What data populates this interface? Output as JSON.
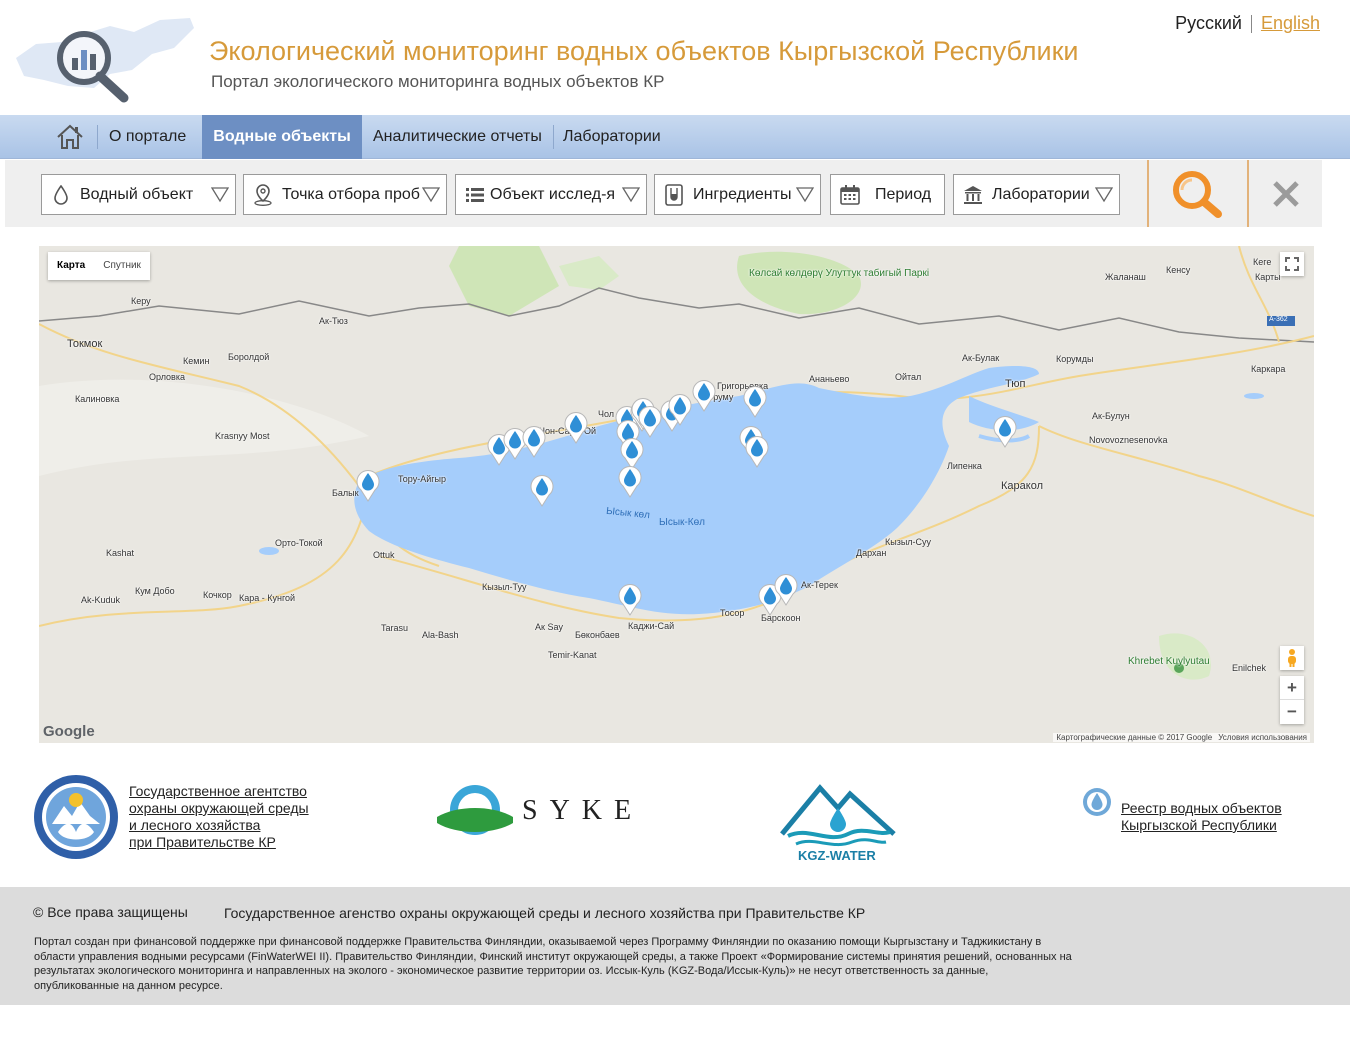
{
  "header": {
    "title": "Экологический мониторинг водных объектов Кыргызской Республики",
    "subtitle": "Портал экологического мониторинга водных объектов КР",
    "lang_ru": "Русский",
    "lang_en": "English"
  },
  "nav": {
    "items": [
      {
        "label": "О портале"
      },
      {
        "label": "Водные объекты",
        "active": true
      },
      {
        "label": "Аналитические отчеты"
      },
      {
        "label": "Лаборатории"
      }
    ]
  },
  "filters": {
    "water_object": "Водный объект",
    "sampling_point": "Точка отбора проб",
    "research_object": "Объект исслед-я",
    "ingredients": "Ингредиенты",
    "period": "Период",
    "laboratories": "Лаборатории"
  },
  "map": {
    "type_map": "Карта",
    "type_satellite": "Спутник",
    "attribution": "Картографические данные © 2017 Google",
    "terms": "Условия использования",
    "google": "Google",
    "labels": {
      "kerу": "Керу",
      "ak_tyuz": "Ак-Тюз",
      "tokmok": "Токмок",
      "kemin": "Кемин",
      "borolday": "Боролдой",
      "orlovka": "Орловка",
      "kalinovka": "Калиновка",
      "krasny_most": "Krasnyy Most",
      "balykchy": "Балык",
      "toru_aygyr": "Тору-Айгыр",
      "chon_sary_oy": "Чон-Сары-Ой",
      "cholpon": "Чол",
      "koruma": "Коруму",
      "grigorevka": "Григорьевка",
      "ananevo": "Ананьево",
      "oytal": "Ойтал",
      "park": "Көлсай көлдөрү Улуттук табигый Паркі",
      "zhalanash": "Жаланаш",
      "kensu": "Кенсу",
      "kegen": "Кеге",
      "karty": "Карты",
      "a362": "А-362",
      "ak_bulak": "Ак-Булак",
      "korumdy": "Корумды",
      "tyup": "Тюп",
      "karkara": "Каркара",
      "ak_bulun": "Ак-Булун",
      "novovoz": "Novovoznesenovka",
      "lipenka": "Липенка",
      "karakol": "Каракол",
      "lake1": "Ысык көл",
      "lake2": "Ысык-Көл",
      "orto_tokoy": "Орто-Токой",
      "ottuk": "Ottuk",
      "kashat": "Kashat",
      "kyzyl_suu": "Кызыл-Суу",
      "darkhan": "Дархан",
      "ak_terek": "Ак-Терек",
      "kum_dobo": "Кум Добо",
      "ak_kuduk": "Ak-Kuduk",
      "kochkor": "Кочкор",
      "kara_kungoy": "Кара - Кунгой",
      "kyzyl_tuu": "Кызыл-Туу",
      "tosor": "Тосор",
      "barskoon": "Барскоон",
      "kadzhi_say": "Каджи-Сай",
      "ak_say": "Ак Say",
      "bokonbaev": "Бөконбаев",
      "tarasu": "Tarasu",
      "ala_bash": "Ala-Bash",
      "temir_kanat": "Temir-Kanat",
      "khrebet": "Khrebet Kuylyutau",
      "enilchek": "Enilchek"
    }
  },
  "partners": {
    "agency": [
      "Государственное агентство",
      "охраны окружающей среды",
      "и лесного хозяйства",
      "при Правительстве КР"
    ],
    "syke": "SYKE",
    "kgz_water": "KGZ-WATER",
    "registry": [
      "Реестр водных объектов",
      "Кыргызской Республики"
    ]
  },
  "footer": {
    "copyright": "© Все права защищены",
    "agency": "Государственное агенство охраны окружающей среды и лесного хозяйства при Правительстве КР",
    "note": "Портал создан при финансовой поддержке при финансовой поддержке Правительства Финляндии, оказываемой через Программу Финляндии по оказанию помощи Кыргызстану и Таджикистану в области управления водными ресурсами (FinWaterWEI II). Правительство Финляндии, Финский институт окружающей среды, а также Проект «Формирование системы принятия решений, основанных на результатах экологического мониторинга и направленных на эколого - экономическое развитие территории оз. Иссык-Куль (KGZ-Вода/Иссык-Куль)» не несут ответственность за данные, опубликованные на данном ресурсе."
  },
  "colors": {
    "accent": "#d69a3a",
    "nav_active": "#6d8fc3",
    "lake": "#a5cdfb",
    "marker": "#2f8fd6"
  }
}
